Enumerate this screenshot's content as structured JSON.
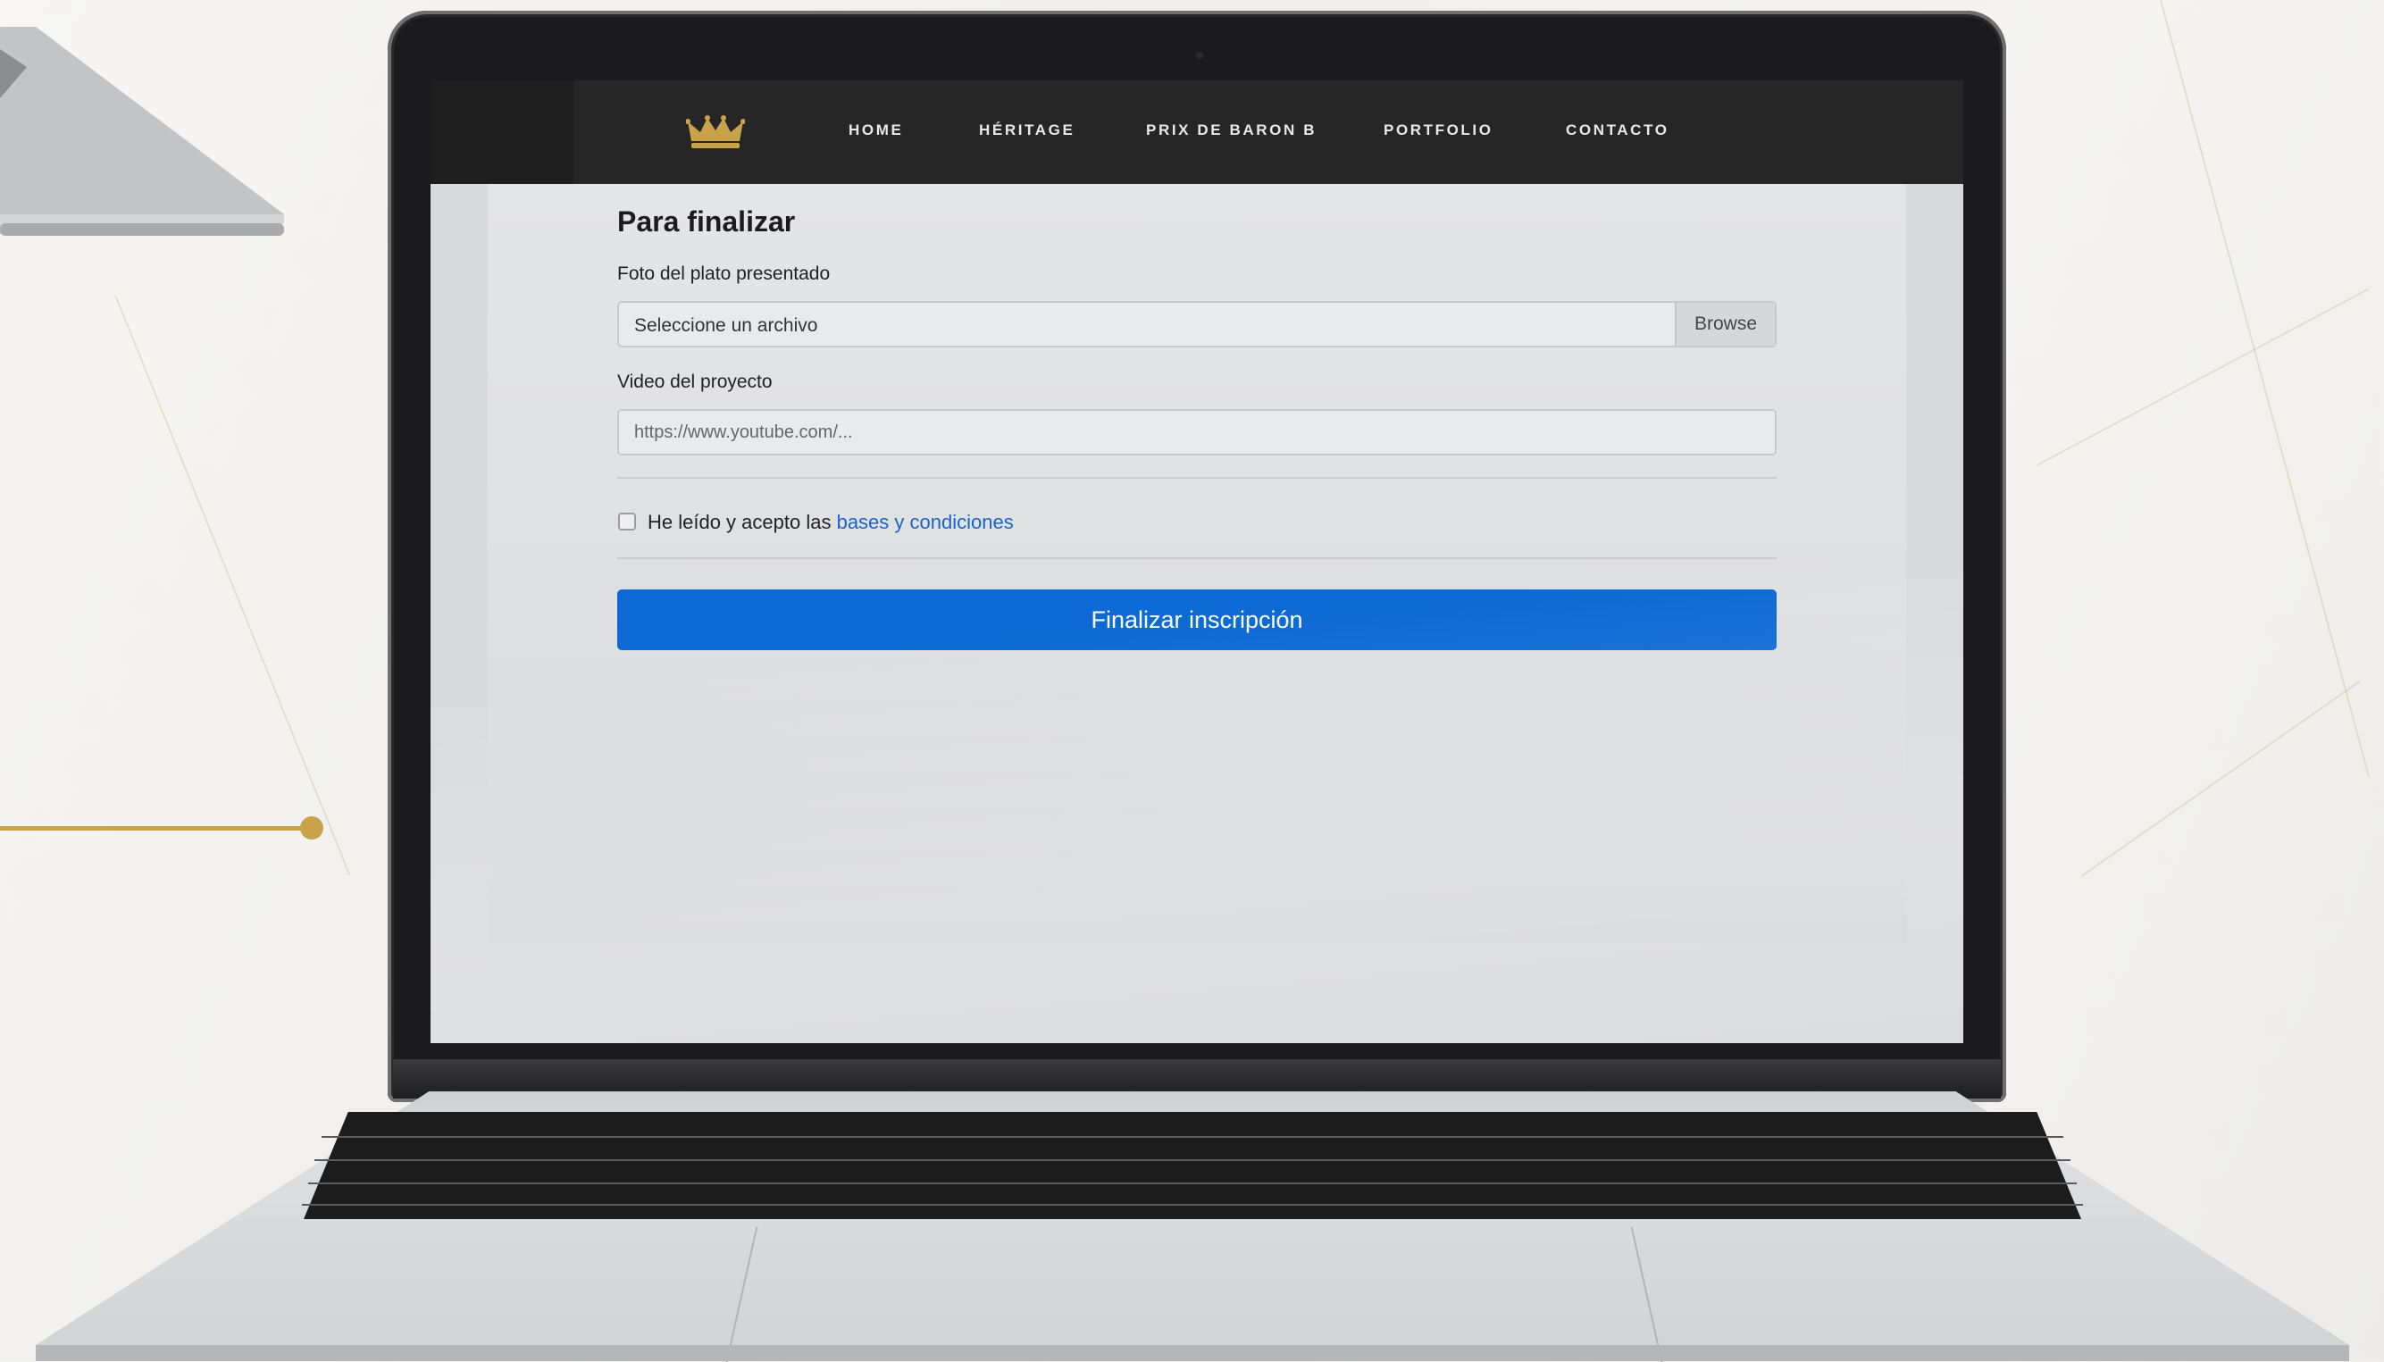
{
  "nav": {
    "logo_icon": "crown-icon",
    "items": [
      {
        "label": "HOME"
      },
      {
        "label": "HÉRITAGE"
      },
      {
        "label": "PRIX DE BARON B"
      },
      {
        "label": "PORTFOLIO"
      },
      {
        "label": "CONTACTO"
      }
    ]
  },
  "form": {
    "title": "Para finalizar",
    "photo_label": "Foto del plato presentado",
    "photo_placeholder": "Seleccione un archivo",
    "browse_label": "Browse",
    "video_label": "Video del proyecto",
    "video_placeholder": "https://www.youtube.com/...",
    "terms_prefix": "He leído y acepto las ",
    "terms_link": "bases y condiciones",
    "terms_checked": false,
    "submit_label": "Finalizar inscripción"
  },
  "colors": {
    "accent_gold": "#c9a34a",
    "primary_button": "#0d6ad4",
    "link": "#1a63c9",
    "navbar": "#262626"
  }
}
